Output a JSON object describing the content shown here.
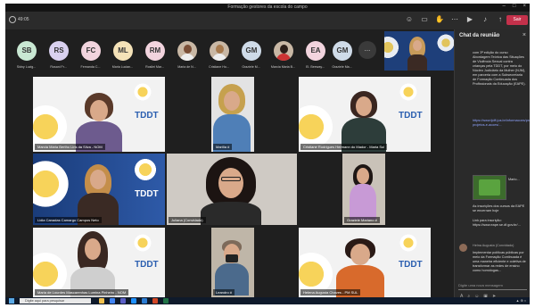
{
  "window": {
    "title": "Formação gestores da escola do campo"
  },
  "toolbar": {
    "timer": "49:05",
    "leave_label": "Sair"
  },
  "participants": [
    {
      "initials": "SB",
      "name": "Sidny Luzig...",
      "color": "#c9e8d3"
    },
    {
      "initials": "RS",
      "name": "Rosani Fr...",
      "color": "#d9d1ef"
    },
    {
      "initials": "FC",
      "name": "Fernanda C...",
      "color": "#f2d4de"
    },
    {
      "initials": "ML",
      "name": "Maria Lucian...",
      "color": "#f4e2b8"
    },
    {
      "initials": "RM",
      "name": "Rosilei Mar...",
      "color": "#f2d4de"
    },
    {
      "initials": "",
      "name": "Maria de N...",
      "color": "#c9b8a5"
    },
    {
      "initials": "",
      "name": "Cristiane Ho...",
      "color": "#c9b8a5"
    },
    {
      "initials": "GM",
      "name": "Graziele M...",
      "color": "#cfdbe8"
    },
    {
      "initials": "",
      "name": "Marcia Maria B...",
      "color": "#c9b8a5"
    },
    {
      "initials": "EA",
      "name": "El. Beeway...",
      "color": "#f2d4de"
    },
    {
      "initials": "GM",
      "name": "Graziele Ma...",
      "color": "#cfdbe8"
    }
  ],
  "more_label": "...",
  "tiles": [
    {
      "label": "Marcia Maria Bertho Lins da Silva - NOM",
      "brand": "TDDT"
    },
    {
      "label": "Marília #",
      "brand": ""
    },
    {
      "label": "Cristiane Rodrigues Hermann do Mador - Maria Sul",
      "brand": "TDDT"
    },
    {
      "label": "Lidia Canadas Camargo Campos Neto",
      "brand": "TDDT"
    },
    {
      "label": "Juliana (Convidado)",
      "brand": ""
    },
    {
      "label": "Graziele Mariano #",
      "brand": ""
    },
    {
      "label": "Maria de Lourdes Mascarenhas Lumina Pinheiro - NOM",
      "brand": "TDDT"
    },
    {
      "label": "Leandro #",
      "brand": ""
    },
    {
      "label": "Helena Augusta Chaves - PM SUL",
      "brand": "TDDT"
    }
  ],
  "chat": {
    "title": "Chat da reunião",
    "messages": [
      "com 3ª edição do curso Abordagem Teórica das Situações de Violência Sexual contra crianças pela TDDT, por meio do Núcleo Judiciário da Mulher (NJM), em parceria com a Subsecretaria de Formação Continuada dos Profissionais da Educação (EAPE).",
      "https://www.tjdft.jus.br/informacoes/programas-projetos-e-acoes/...",
      "As inscrições dos cursos da EAPE se encerram hoje",
      "Link para inscrição: https://www.eape.se.df.gov.br/...",
      "Implementar políticas públicas por meio da Formação Continuada é uma maneira eficiente e coletiva de transformar as redes de ensino como homólogas..."
    ],
    "image_name": "Mario...",
    "sender": "Helna Augusta (Convidado)",
    "compose_placeholder": "Digite uma nova mensagem"
  },
  "taskbar": {
    "search_placeholder": "Digite aqui para pesquisar"
  }
}
